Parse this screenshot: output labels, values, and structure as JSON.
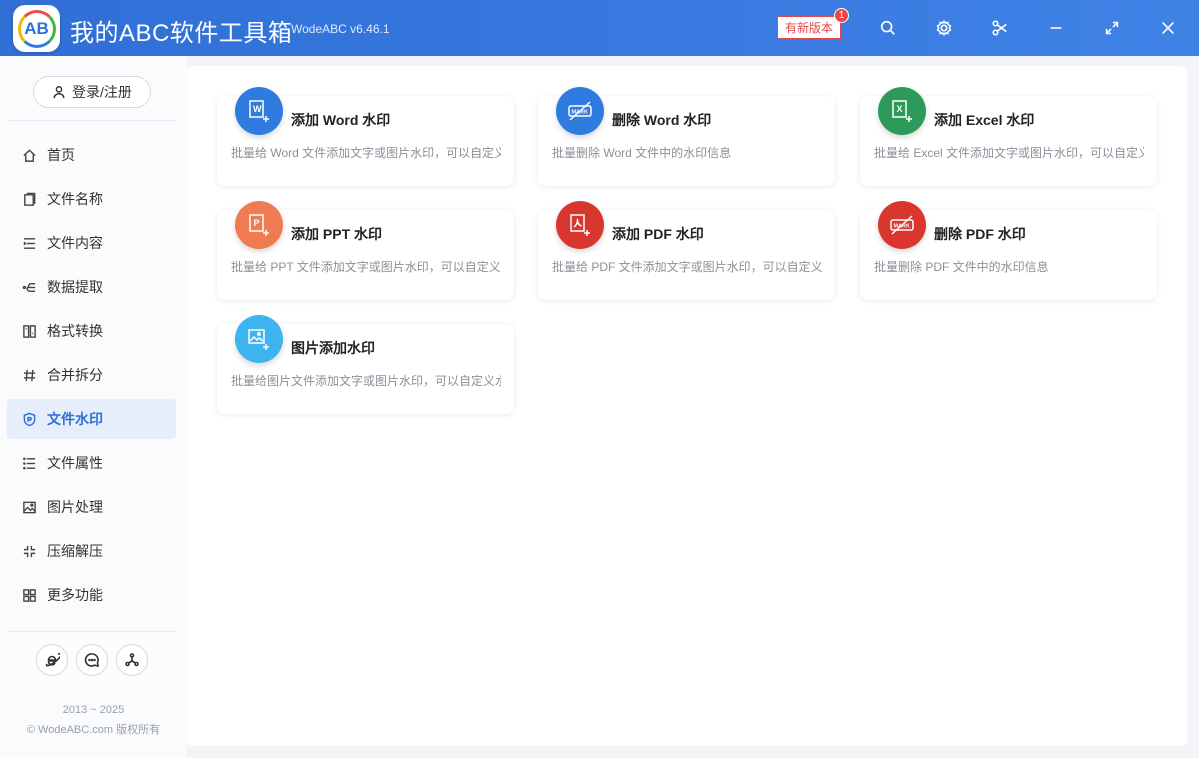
{
  "titlebar": {
    "logo_text": "AB",
    "title": "我的ABC软件工具箱",
    "version": "WodeABC v6.46.1",
    "update_label": "有新版本",
    "update_badge": "1"
  },
  "sidebar": {
    "login_label": "登录/注册",
    "items": [
      {
        "label": "首页",
        "icon": "home-icon"
      },
      {
        "label": "文件名称",
        "icon": "file-name-icon"
      },
      {
        "label": "文件内容",
        "icon": "file-content-icon"
      },
      {
        "label": "数据提取",
        "icon": "data-extract-icon"
      },
      {
        "label": "格式转换",
        "icon": "format-convert-icon"
      },
      {
        "label": "合并拆分",
        "icon": "merge-split-icon"
      },
      {
        "label": "文件水印",
        "icon": "watermark-icon",
        "active": true
      },
      {
        "label": "文件属性",
        "icon": "file-property-icon"
      },
      {
        "label": "图片处理",
        "icon": "image-icon"
      },
      {
        "label": "压缩解压",
        "icon": "compress-icon"
      },
      {
        "label": "更多功能",
        "icon": "more-icon"
      }
    ],
    "copyright_years": "2013 ~ 2025",
    "copyright_text": "© WodeABC.com 版权所有"
  },
  "cards": [
    {
      "title": "添加 Word 水印",
      "desc": "批量给 Word 文件添加文字或图片水印，可以自定义",
      "icon": "word-add-icon",
      "color": "#2f7be0"
    },
    {
      "title": "删除 Word 水印",
      "desc": "批量删除 Word 文件中的水印信息",
      "icon": "word-remove-mark-icon",
      "color": "#2f7be0"
    },
    {
      "title": "添加 Excel 水印",
      "desc": "批量给 Excel 文件添加文字或图片水印，可以自定义",
      "icon": "excel-add-icon",
      "color": "#2e9a5a"
    },
    {
      "title": "添加 PPT 水印",
      "desc": "批量给 PPT 文件添加文字或图片水印，可以自定义水",
      "icon": "ppt-add-icon",
      "color": "#f07a52"
    },
    {
      "title": "添加 PDF 水印",
      "desc": "批量给 PDF 文件添加文字或图片水印，可以自定义水",
      "icon": "pdf-add-icon",
      "color": "#d8362e"
    },
    {
      "title": "删除 PDF 水印",
      "desc": "批量删除 PDF 文件中的水印信息",
      "icon": "pdf-remove-mark-icon",
      "color": "#d8362e"
    },
    {
      "title": "图片添加水印",
      "desc": "批量给图片文件添加文字或图片水印，可以自定义水",
      "icon": "image-add-icon",
      "color": "#3db4ef"
    }
  ]
}
